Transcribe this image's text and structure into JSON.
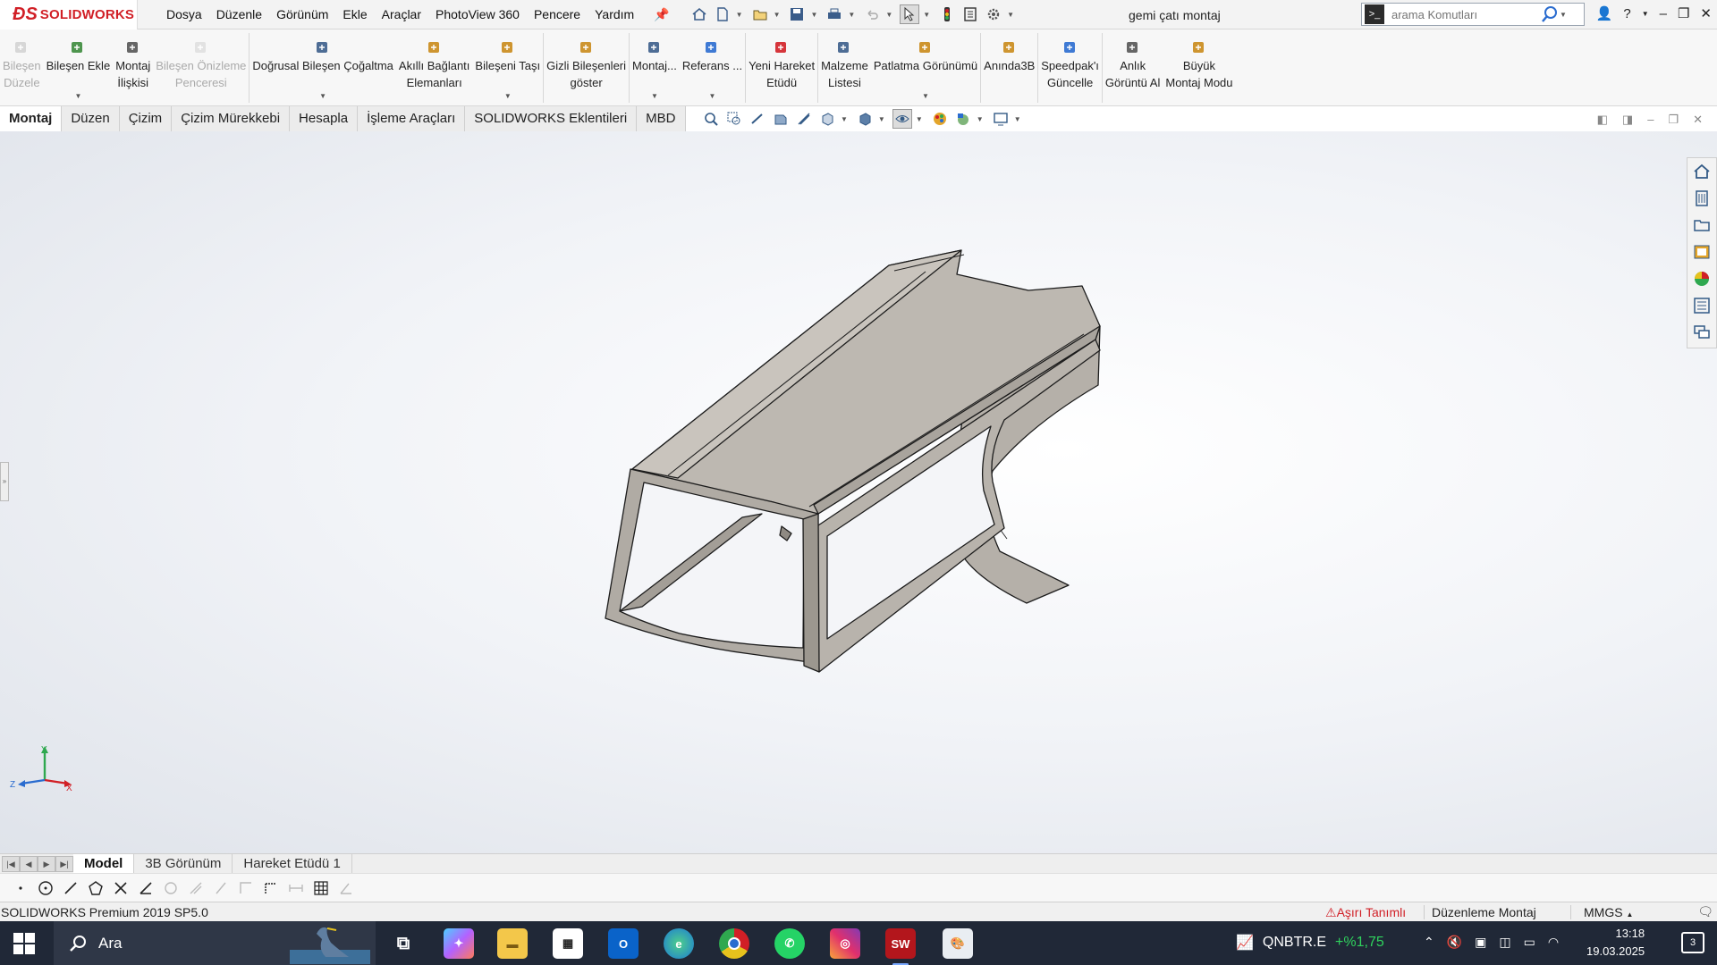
{
  "app": {
    "logo": "SOLIDWORKS"
  },
  "menu": [
    "Dosya",
    "Düzenle",
    "Görünüm",
    "Ekle",
    "Araçlar",
    "PhotoView 360",
    "Pencere",
    "Yardım"
  ],
  "document_title": "gemi çatı montaj",
  "search": {
    "placeholder": "arama Komutları"
  },
  "commands": [
    {
      "label": "Bileşen\nDüzele",
      "icon": "edit-component-icon",
      "disabled": true
    },
    {
      "label": "Bileşen Ekle",
      "icon": "insert-component-icon",
      "dropdown": true
    },
    {
      "label": "Montaj\nİlişkisi",
      "icon": "mate-icon"
    },
    {
      "label": "Bileşen Önizleme\nPenceresi",
      "icon": "preview-window-icon",
      "disabled": true
    },
    {
      "label": "Doğrusal Bileşen Çoğaltma",
      "icon": "linear-pattern-icon",
      "dropdown": true
    },
    {
      "label": "Akıllı Bağlantı\nElemanları",
      "icon": "smart-fasteners-icon"
    },
    {
      "label": "Bileşeni Taşı",
      "icon": "move-component-icon",
      "dropdown": true
    },
    {
      "label": "Gizli Bileşenleri\ngöster",
      "icon": "show-hidden-icon"
    },
    {
      "label": "Montaj...",
      "icon": "assembly-features-icon",
      "dropdown": true
    },
    {
      "label": "Referans ...",
      "icon": "reference-geometry-icon",
      "dropdown": true
    },
    {
      "label": "Yeni Hareket\nEtüdü",
      "icon": "motion-study-icon"
    },
    {
      "label": "Malzeme\nListesi",
      "icon": "bom-icon"
    },
    {
      "label": "Patlatma Görünümü",
      "icon": "exploded-view-icon",
      "dropdown": true
    },
    {
      "label": "Anında3B",
      "icon": "instant3d-icon"
    },
    {
      "label": "Speedpak'ı\nGüncelle",
      "icon": "speedpak-icon"
    },
    {
      "label": "Anlık\nGörüntü Al",
      "icon": "snapshot-icon"
    },
    {
      "label": "Büyük\nMontaj Modu",
      "icon": "large-assembly-icon"
    }
  ],
  "tabs": [
    "Montaj",
    "Düzen",
    "Çizim",
    "Çizim Mürekkebi",
    "Hesapla",
    "İşleme Araçları",
    "SOLIDWORKS Eklentileri",
    "MBD"
  ],
  "active_tab": "Montaj",
  "bottom_tabs": [
    "Model",
    "3B Görünüm",
    "Hareket Etüdü 1"
  ],
  "active_bottom_tab": "Model",
  "triad": {
    "x": "X",
    "y": "Y",
    "z": "Z"
  },
  "status": {
    "version": "SOLIDWORKS Premium 2019 SP5.0",
    "warning": "Aşırı Tanımlı",
    "mode": "Düzenleme Montaj",
    "units": "MMGS"
  },
  "taskbar": {
    "search_label": "Ara",
    "ticker_symbol": "QNBTR.E",
    "ticker_change": "+%1,75",
    "time": "13:18",
    "date": "19.03.2025",
    "notifications": "3"
  },
  "colors": {
    "brand": "#d11f26",
    "model_fill": "#bdb8b1",
    "taskbar": "#202837"
  }
}
